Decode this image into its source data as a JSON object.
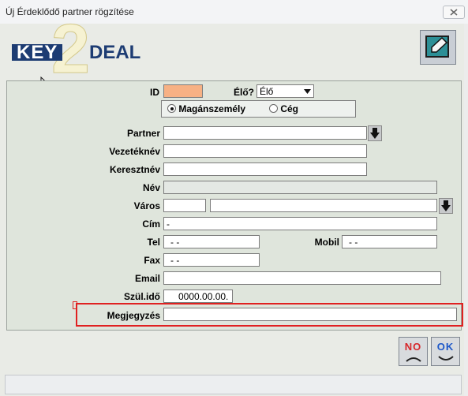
{
  "window": {
    "title": "Új Érdeklődő partner rögzítése"
  },
  "colors": {
    "accent": "#1d3c73",
    "highlight": "#e02121",
    "id_field": "#f7b184"
  },
  "logo": {
    "key": "KEY",
    "two": "2",
    "deal": "DEAL"
  },
  "toolbar": {
    "edit_icon": "edit-icon"
  },
  "form": {
    "id_label": "ID",
    "id_value": "",
    "alive_label": "Élő?",
    "alive_value": "Élő",
    "radio_person": "Magánszemély",
    "radio_company": "Cég",
    "partner_label": "Partner",
    "partner_value": "",
    "lastname_label": "Vezetéknév",
    "lastname_value": "",
    "firstname_label": "Keresztnév",
    "firstname_value": "",
    "name_label": "Név",
    "name_value": "",
    "city_label": "Város",
    "city_zip_value": "",
    "city_value": "",
    "address_label": "Cím",
    "address_value": "-",
    "tel_label": "Tel",
    "tel_value": "-  -",
    "mobile_label": "Mobil",
    "mobile_value": "-  -",
    "fax_label": "Fax",
    "fax_value": "-  -",
    "email_label": "Email",
    "email_value": "",
    "birth_label": "Szül.idő",
    "birth_value": "0000.00.00.",
    "note_label": "Megjegyzés",
    "note_value": ""
  },
  "buttons": {
    "no_label": "NO",
    "ok_label": "OK"
  }
}
